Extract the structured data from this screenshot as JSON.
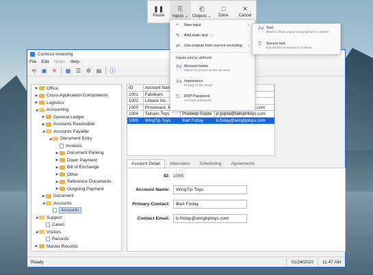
{
  "recorder": {
    "buttons": [
      {
        "icon": "pause",
        "label": "Pause"
      },
      {
        "icon": "inputs",
        "label": "Inputs"
      },
      {
        "icon": "outputs",
        "label": "Outputs"
      },
      {
        "icon": "done",
        "label": "Done"
      },
      {
        "icon": "cancel",
        "label": "Cancel"
      }
    ]
  },
  "inputs_menu": {
    "items": [
      {
        "label": "New input",
        "icon": "plus-icon"
      },
      {
        "label": "Add static text",
        "icon": "text-icon"
      },
      {
        "label": "Use outputs from current recording",
        "icon": "link-icon"
      }
    ],
    "section": "Inputs you've defined",
    "defined": [
      {
        "name": "Account name",
        "desc": "Name of person on the account"
      },
      {
        "name": "Importance",
        "desc": "Priority of the email"
      },
      {
        "name": "RDP Password",
        "desc": "Account password"
      }
    ]
  },
  "submenu": [
    {
      "name": "Text",
      "desc": "Binds to flow output using dynamic content"
    },
    {
      "name": "Secure text",
      "desc": "Not shown or stored in UI flows"
    }
  ],
  "window": {
    "title": "Contoso Invoicing"
  },
  "menubar": [
    "File",
    "Edit",
    "Notes",
    "Help"
  ],
  "tree": [
    {
      "label": "Office",
      "level": 0,
      "type": "folder",
      "arrow": "▶"
    },
    {
      "label": "Cross-Application Components",
      "level": 0,
      "type": "folder",
      "arrow": "▶"
    },
    {
      "label": "Logistics",
      "level": 0,
      "type": "folder",
      "arrow": "▶"
    },
    {
      "label": "Accounting",
      "level": 0,
      "type": "folder-open",
      "arrow": "◢"
    },
    {
      "label": "General Ledger",
      "level": 1,
      "type": "folder",
      "arrow": "▶"
    },
    {
      "label": "Accounts Receivable",
      "level": 1,
      "type": "folder",
      "arrow": "▶"
    },
    {
      "label": "Accounts Payable",
      "level": 1,
      "type": "folder-open",
      "arrow": "◢"
    },
    {
      "label": "Document Entry",
      "level": 2,
      "type": "folder-open",
      "arrow": "◢"
    },
    {
      "label": "Invoices",
      "level": 3,
      "type": "page",
      "arrow": ""
    },
    {
      "label": "Document Parking",
      "level": 3,
      "type": "folder",
      "arrow": "▶"
    },
    {
      "label": "Down Payment",
      "level": 3,
      "type": "folder",
      "arrow": "▶"
    },
    {
      "label": "Bill of Exchange",
      "level": 3,
      "type": "folder",
      "arrow": "▶"
    },
    {
      "label": "Other",
      "level": 3,
      "type": "folder",
      "arrow": "▶"
    },
    {
      "label": "Reference Documents",
      "level": 3,
      "type": "folder",
      "arrow": "▶"
    },
    {
      "label": "Outgoing Payment",
      "level": 3,
      "type": "folder",
      "arrow": "▶"
    },
    {
      "label": "Document",
      "level": 1,
      "type": "folder",
      "arrow": "▶"
    },
    {
      "label": "Accounts",
      "level": 1,
      "type": "folder-open",
      "arrow": "◢"
    },
    {
      "label": "Accounts",
      "level": 2,
      "type": "page",
      "arrow": "",
      "selected": true
    },
    {
      "label": "Support",
      "level": 0,
      "type": "folder-open",
      "arrow": "◢"
    },
    {
      "label": "Cases",
      "level": 1,
      "type": "page",
      "arrow": ""
    },
    {
      "label": "Visitors",
      "level": 0,
      "type": "folder-open",
      "arrow": "◢"
    },
    {
      "label": "Records",
      "level": 1,
      "type": "page",
      "arrow": ""
    },
    {
      "label": "Master Records",
      "level": 0,
      "type": "folder",
      "arrow": "▶"
    }
  ],
  "grid": {
    "columns": [
      "ID",
      "Account Nam",
      "",
      ""
    ],
    "rows": [
      [
        "1001",
        "Fabrikam",
        "",
        "com"
      ],
      [
        "1002",
        "Litware Inc.",
        "",
        "com"
      ],
      [
        "1003",
        "Proseware, Inc.",
        "Lynne Robbins",
        "lrobbins@proseware.com"
      ],
      [
        "1004",
        "Tailspin Toys",
        "Pradeep Gupta",
        "p.gupta@tailspintoys.com"
      ],
      [
        "1005",
        "WingTip Toys",
        "Bart Friday",
        "b.friday@wingtiptoys.com"
      ]
    ],
    "selected_index": 4
  },
  "tabs": [
    "Account Detail",
    "Alternates",
    "Scheduling",
    "Agreements"
  ],
  "detail": {
    "id_label": "ID:",
    "id_value": "1005",
    "name_label": "Account Name:",
    "name_value": "WingTip Toys",
    "contact_label": "Primary Contact:",
    "contact_value": "Bart Friday",
    "email_label": "Contact Email:",
    "email_value": "b.friday@wingtiptoys.com"
  },
  "status": {
    "text": "Ready",
    "date": "01/24/2020",
    "time": "11:47 AM"
  }
}
